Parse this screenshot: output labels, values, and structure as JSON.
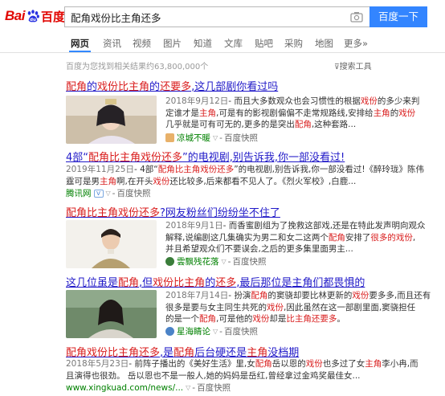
{
  "header": {
    "logo_bai": "Bai",
    "logo_du": "百度",
    "search_value": "配角戏份比主角还多",
    "search_button": "百度一下"
  },
  "tabs": [
    {
      "label": "网页",
      "active": true
    },
    {
      "label": "资讯"
    },
    {
      "label": "视频"
    },
    {
      "label": "图片"
    },
    {
      "label": "知道"
    },
    {
      "label": "文库"
    },
    {
      "label": "贴吧"
    },
    {
      "label": "采购"
    },
    {
      "label": "地图"
    },
    {
      "label": "更多»"
    }
  ],
  "meta": {
    "count_text": "百度为您找到相关结果约63,800,000个",
    "tools_label": "搜索工具"
  },
  "results": [
    {
      "title_parts": [
        "配角",
        "的",
        "戏份比主角",
        "的",
        "还要多",
        ",这几部剧你看过吗"
      ],
      "date": "2018年9月12日",
      "lines": [
        [
          "- 而且大多数观众也会习惯性的根据",
          "戏份",
          "的多少来判"
        ],
        [
          "定谁才是",
          "主角",
          ",可是有的影视剧偏偏不走常规路线,安排给",
          "主角",
          "的",
          "戏份"
        ],
        [
          "几乎就是可有可无的,更多的是突出",
          "配角",
          ",这种套路..."
        ]
      ],
      "source": "凉城不暖",
      "snapshot": "百度快照"
    },
    {
      "title_parts": [
        "4部“",
        "配角比主角戏份还多",
        "”的电视剧,别告诉我,你一部没看过!"
      ],
      "date": "2019年11月25日",
      "lines": [
        [
          "- 4部“",
          "配角比主角戏份还多",
          "”的电视剧,别告诉我,你一部没看过!《醉玲珑》陈伟"
        ],
        [
          "霆可是男",
          "主角",
          "啊,在开头",
          "戏份",
          "还比较多,后来都看不见人了。《烈火军校》,白鹿..."
        ]
      ],
      "source": "腾讯网",
      "badge": "V",
      "snapshot": "百度快照"
    },
    {
      "title_parts": [
        "配角比主角戏份还多",
        "?网友粉丝们纷纷坐不住了"
      ],
      "date": "2018年9月1日",
      "lines": [
        [
          "- 而香蜜剧组为了挽救这部戏,还是在特此发声明向观众"
        ],
        [
          "解释,说编剧这几集确实为男二和女二这两个",
          "配角",
          "安排了",
          "很多的",
          "戏份",
          ","
        ],
        [
          "并且希望观众们不要误会,之后的更多集里面男主..."
        ]
      ],
      "source": "雲飘残花落",
      "snapshot": "百度快照"
    },
    {
      "title_parts": [
        "这几位虽是",
        "配角",
        ",但",
        "戏份比主角",
        "的",
        "还多",
        ",最后那位是主角们都畏惧的"
      ],
      "date": "2018年7月14日",
      "lines": [
        [
          "- 扮演",
          "配角",
          "的窦骁却要比林更新的",
          "戏份",
          "要多多,而且还有"
        ],
        [
          "很多是要与女主同生共死的",
          "戏份",
          ",因此虽然在这一部剧里面,窦骁担任"
        ],
        [
          "的是一个",
          "配角",
          ",可是他的",
          "戏份",
          "却是",
          "比主角还要多",
          "。"
        ]
      ],
      "source": "星海睛论",
      "snapshot": "百度快照"
    },
    {
      "title_parts": [
        "配角戏份比主角还多",
        ",是",
        "配角",
        "后台硬还是",
        "主角",
        "没档期"
      ],
      "date": "2018年5月23日",
      "lines": [
        [
          "- 前阵子播出的《美好生活》里,女",
          "配角",
          "岳以恩的",
          "戏份",
          "也多过了女",
          "主角",
          "李小冉,而"
        ],
        [
          "且演得也很劲。 岳以恩也不是一般人,她的妈妈是岳红,曾经拿过金鸡奖最佳女..."
        ]
      ],
      "source": "www.xingkuad.com/news/...",
      "snapshot": "百度快照"
    }
  ]
}
